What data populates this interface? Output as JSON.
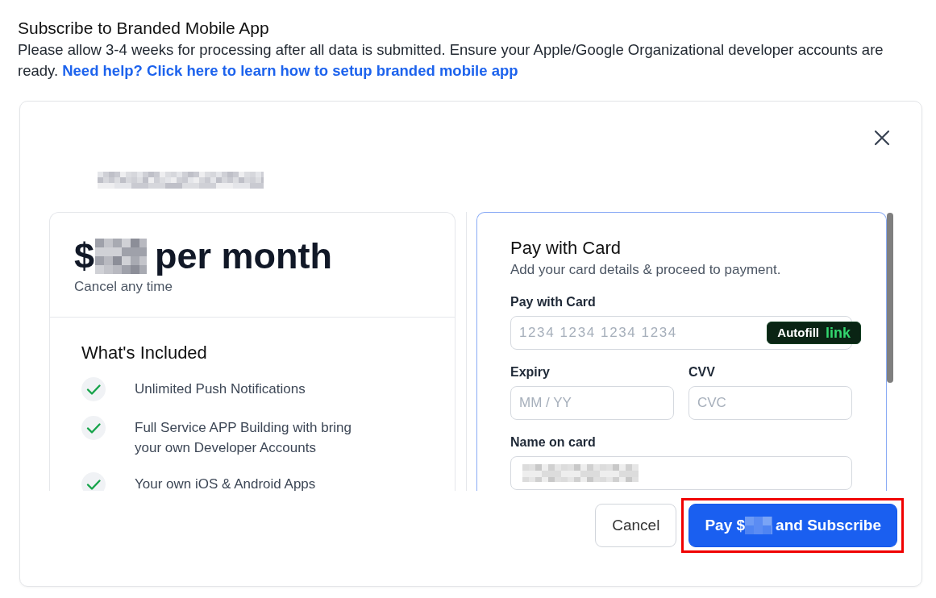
{
  "page": {
    "title": "Subscribe to Branded Mobile App",
    "description": "Please allow 3-4 weeks for processing after all data is submitted. Ensure your Apple/Google Organizational developer accounts are ready.",
    "help_link": "Need help? Click here to learn how to setup branded mobile app"
  },
  "dialog": {
    "app_name_redacted": true,
    "plan": {
      "price_prefix": "$",
      "price_redacted": true,
      "price_suffix": "per month",
      "note": "Cancel any time",
      "included_title": "What's Included",
      "features": [
        {
          "text": "Unlimited Push Notifications",
          "included": true
        },
        {
          "text": "Full Service APP Building with bring your own Developer Accounts",
          "included": true
        },
        {
          "text": "Your own iOS & Android Apps",
          "included": true
        }
      ]
    },
    "payment": {
      "title": "Pay with Card",
      "subtitle": "Add your card details & proceed to payment.",
      "fields": [
        {
          "kind": "card",
          "label": "Pay with Card",
          "placeholder": "1234 1234 1234 1234",
          "autofill": {
            "label": "Autofill",
            "brand": "link"
          }
        },
        {
          "kind": "half",
          "label": "Expiry",
          "placeholder": "MM / YY"
        },
        {
          "kind": "half",
          "label": "CVV",
          "placeholder": "CVC"
        },
        {
          "kind": "full",
          "label": "Name on card",
          "value_redacted": true
        }
      ]
    },
    "buttons": [
      {
        "kind": "secondary",
        "label": "Cancel",
        "highlighted": false
      },
      {
        "kind": "primary",
        "label": "Pay $",
        "amount_redacted": true,
        "label_after": "and Subscribe",
        "highlighted": true
      }
    ]
  }
}
